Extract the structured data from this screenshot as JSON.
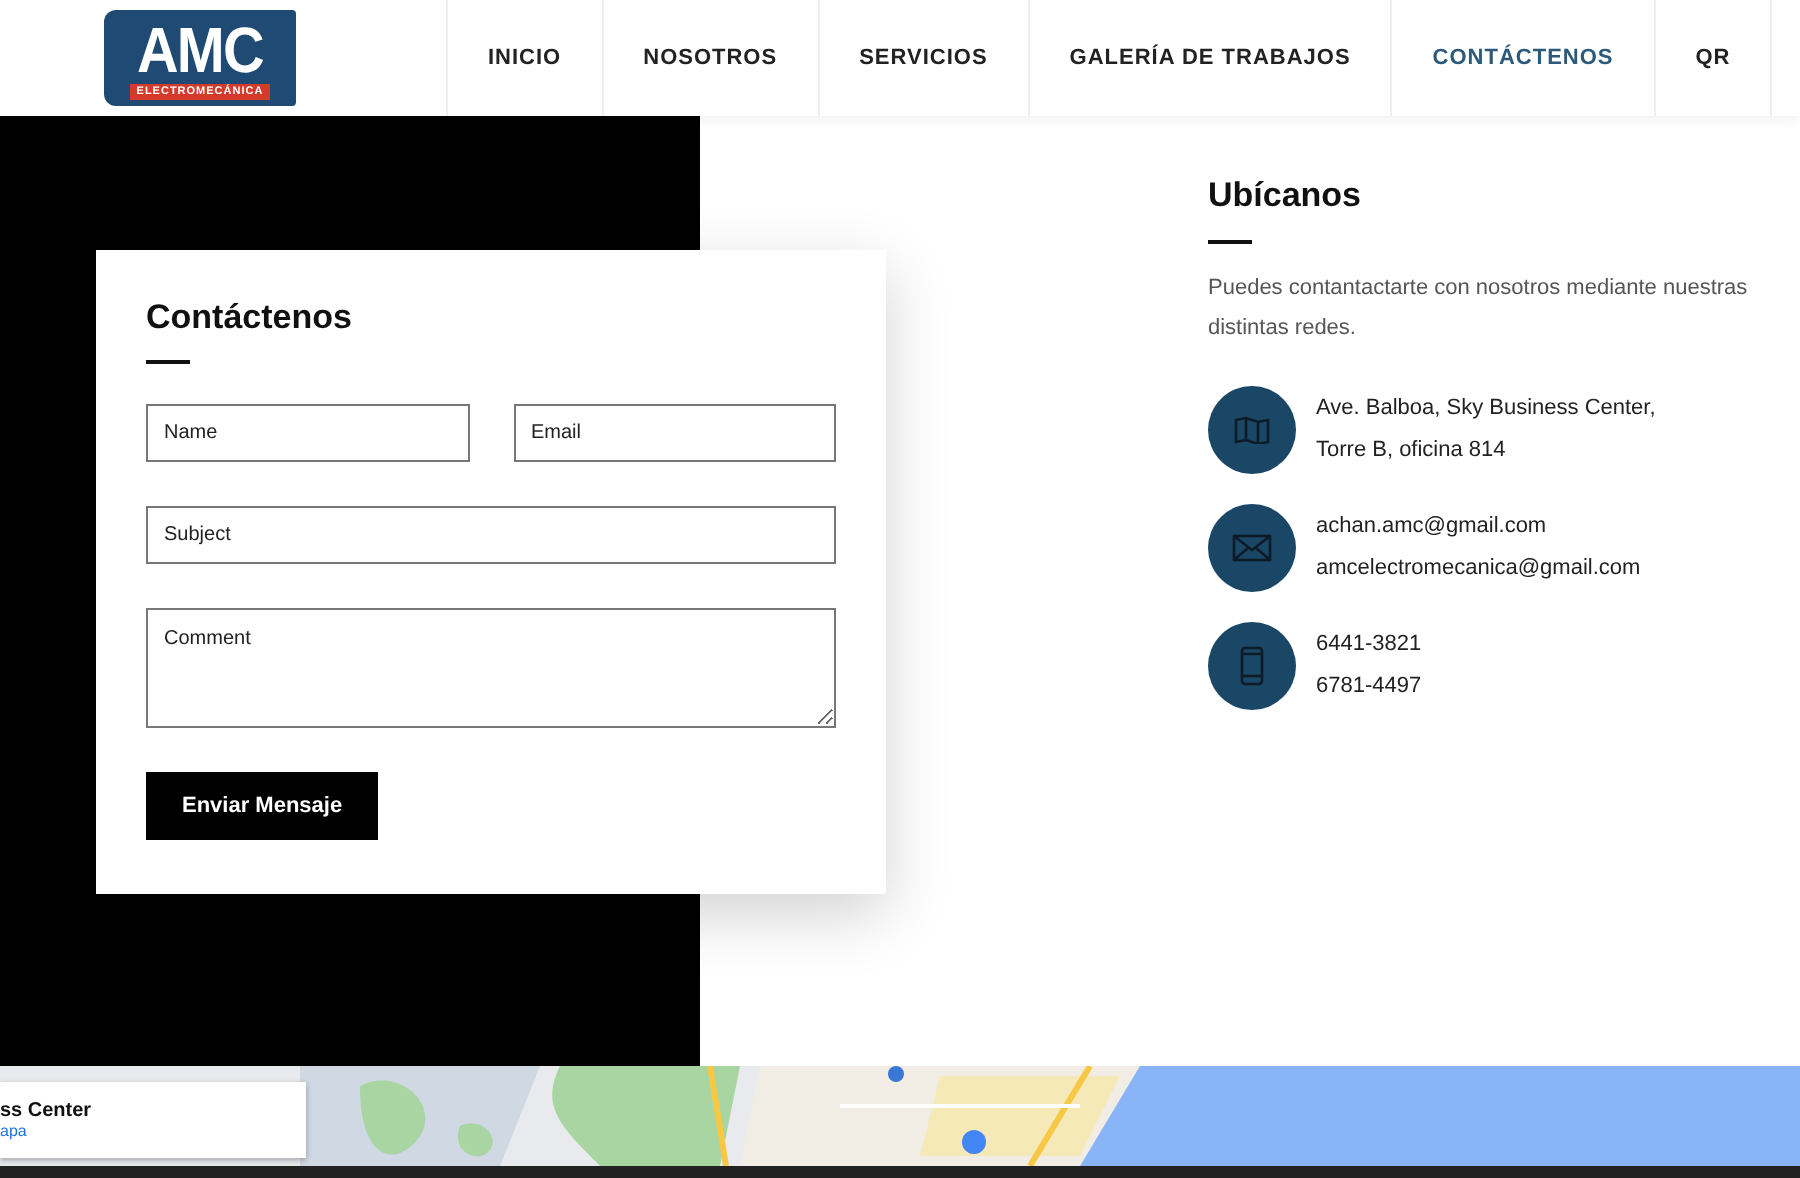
{
  "header": {
    "logo": {
      "letters": "AMC",
      "subtitle": "ELECTROMECÁNICA"
    },
    "nav": [
      {
        "label": "INICIO",
        "selected": false
      },
      {
        "label": "NOSOTROS",
        "selected": false
      },
      {
        "label": "SERVICIOS",
        "selected": false
      },
      {
        "label": "GALERÍA DE TRABAJOS",
        "selected": false
      },
      {
        "label": "CONTÁCTENOS",
        "selected": true
      },
      {
        "label": "QR",
        "selected": false
      }
    ]
  },
  "form": {
    "title": "Contáctenos",
    "name": {
      "placeholder": "Name"
    },
    "email": {
      "placeholder": "Email"
    },
    "subject": {
      "placeholder": "Subject"
    },
    "comment": {
      "placeholder": "Comment"
    },
    "submit": "Enviar Mensaje"
  },
  "location": {
    "title": "Ubícanos",
    "intro": "Puedes contantactarte con nosotros mediante nuestras distintas redes.",
    "items": [
      {
        "kind": "map",
        "lines": [
          "Ave. Balboa, Sky Business Center,",
          "Torre B, oficina 814"
        ]
      },
      {
        "kind": "mail",
        "lines": [
          "achan.amc@gmail.com",
          "amcelectromecanica@gmail.com"
        ]
      },
      {
        "kind": "phone",
        "lines": [
          "6441-3821",
          "6781-4497"
        ]
      }
    ]
  },
  "map": {
    "kind": "picture",
    "card": {
      "title": "ss Center",
      "link": "apa"
    }
  }
}
